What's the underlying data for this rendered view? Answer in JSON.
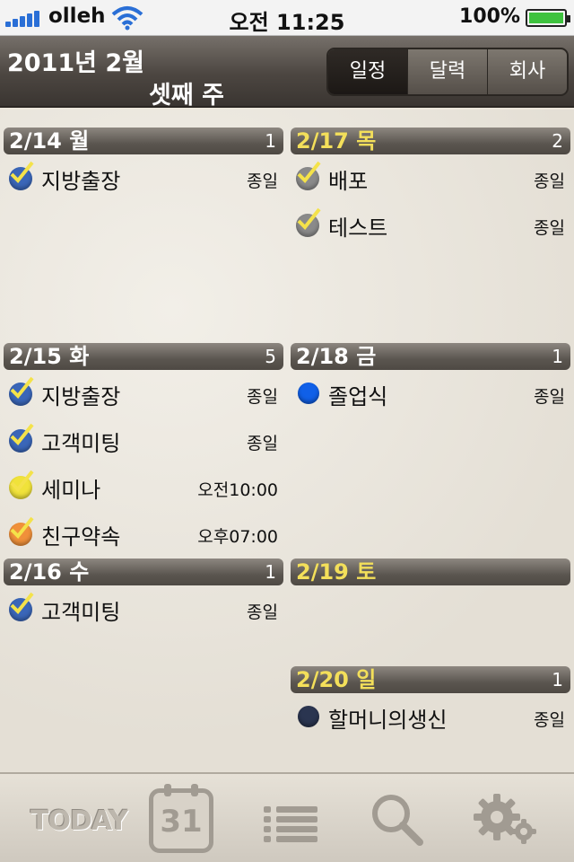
{
  "status_bar": {
    "carrier": "olleh",
    "time": "오전 11:25",
    "battery": "100%"
  },
  "header": {
    "month": "2011년 2월",
    "week": "셋째 주",
    "tabs": [
      {
        "label": "일정",
        "active": true
      },
      {
        "label": "달력",
        "active": false
      },
      {
        "label": "회사",
        "active": false
      }
    ]
  },
  "days": {
    "mon": {
      "label": "2/14 월",
      "count": "1",
      "events": [
        {
          "title": "지방출장",
          "time": "종일"
        }
      ]
    },
    "tue": {
      "label": "2/15 화",
      "count": "5",
      "events": [
        {
          "title": "지방출장",
          "time": "종일"
        },
        {
          "title": "고객미팅",
          "time": "종일"
        },
        {
          "title": "세미나",
          "time": "오전10:00"
        },
        {
          "title": "친구약속",
          "time": "오후07:00"
        }
      ]
    },
    "wed": {
      "label": "2/16 수",
      "count": "1",
      "events": [
        {
          "title": "고객미팅",
          "time": "종일"
        }
      ]
    },
    "thu": {
      "label": "2/17 목",
      "count": "2",
      "events": [
        {
          "title": "배포",
          "time": "종일"
        },
        {
          "title": "테스트",
          "time": "종일"
        }
      ]
    },
    "fri": {
      "label": "2/18 금",
      "count": "1",
      "events": [
        {
          "title": "졸업식",
          "time": "종일"
        }
      ]
    },
    "sat": {
      "label": "2/19 토",
      "count": "",
      "events": []
    },
    "sun": {
      "label": "2/20 일",
      "count": "1",
      "events": [
        {
          "title": "할머니의생신",
          "time": "종일"
        }
      ]
    }
  },
  "colors": {
    "blue_check": "#3a66b8",
    "gray_check": "#8a8a8a",
    "yellow_check": "#f0e23a",
    "orange_check": "#f0903a",
    "blue_dot": "#1060e8",
    "navy_dot": "#2a3550",
    "highlight_day": "#f3df5a"
  },
  "tabbar": {
    "today_label": "TODAY",
    "calendar_date": "31",
    "icons": [
      "today-icon",
      "calendar-icon",
      "list-icon",
      "search-icon",
      "settings-icon"
    ]
  }
}
